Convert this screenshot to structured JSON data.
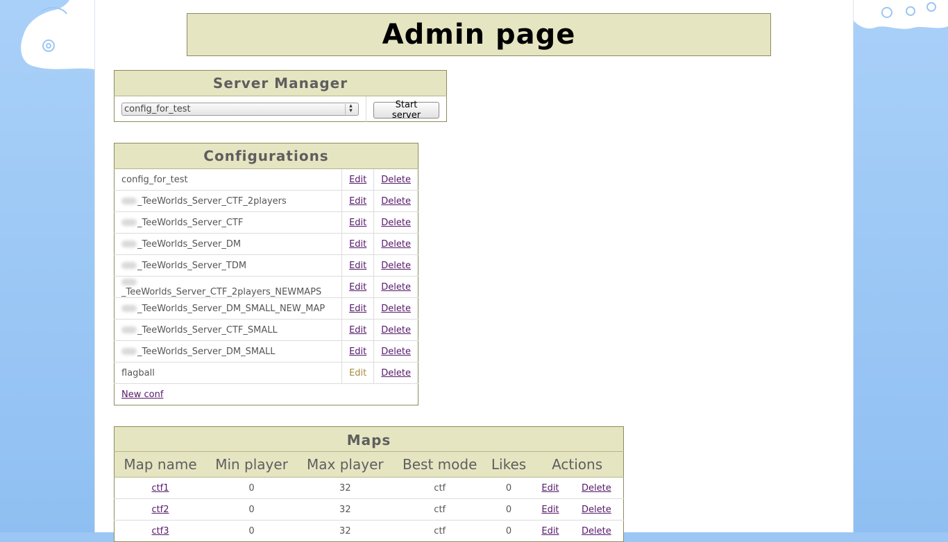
{
  "page": {
    "title": "Admin page"
  },
  "server_manager": {
    "heading": "Server Manager",
    "selected_config": "config_for_test",
    "start_label": "Start server"
  },
  "configurations": {
    "heading": "Configurations",
    "edit_label": "Edit",
    "delete_label": "Delete",
    "rows": [
      {
        "name": "config_for_test",
        "blurred_prefix": false,
        "edit_disabled": false
      },
      {
        "name": "_TeeWorlds_Server_CTF_2players",
        "blurred_prefix": true,
        "edit_disabled": false
      },
      {
        "name": "_TeeWorlds_Server_CTF",
        "blurred_prefix": true,
        "edit_disabled": false
      },
      {
        "name": "_TeeWorlds_Server_DM",
        "blurred_prefix": true,
        "edit_disabled": false
      },
      {
        "name": "_TeeWorlds_Server_TDM",
        "blurred_prefix": true,
        "edit_disabled": false
      },
      {
        "name": "_TeeWorlds_Server_CTF_2players_NEWMAPS",
        "blurred_prefix": true,
        "edit_disabled": false
      },
      {
        "name": "_TeeWorlds_Server_DM_SMALL_NEW_MAP",
        "blurred_prefix": true,
        "edit_disabled": false
      },
      {
        "name": "_TeeWorlds_Server_CTF_SMALL",
        "blurred_prefix": true,
        "edit_disabled": false
      },
      {
        "name": "_TeeWorlds_Server_DM_SMALL",
        "blurred_prefix": true,
        "edit_disabled": false
      },
      {
        "name": "flagball",
        "blurred_prefix": false,
        "edit_disabled": true
      }
    ],
    "new_label": "New conf"
  },
  "maps": {
    "heading": "Maps",
    "columns": [
      "Map name",
      "Min player",
      "Max player",
      "Best mode",
      "Likes",
      "Actions"
    ],
    "edit_label": "Edit",
    "delete_label": "Delete",
    "rows": [
      {
        "name": "ctf1",
        "min": "0",
        "max": "32",
        "mode": "ctf",
        "likes": "0"
      },
      {
        "name": "ctf2",
        "min": "0",
        "max": "32",
        "mode": "ctf",
        "likes": "0"
      },
      {
        "name": "ctf3",
        "min": "0",
        "max": "32",
        "mode": "ctf",
        "likes": "0"
      }
    ]
  },
  "colors": {
    "panel_bg": "#e6e5c2",
    "panel_border": "#8c8a5c",
    "link": "#55186a",
    "background": "#9cc6f4"
  }
}
